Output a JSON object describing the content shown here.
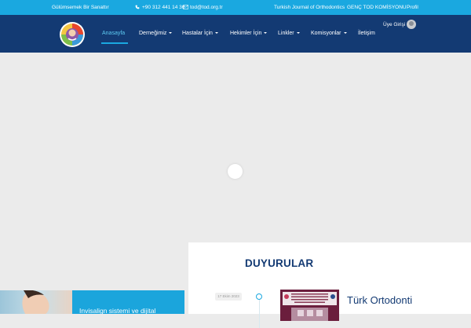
{
  "topbar": {
    "slogan": "Gülümsemek Bir Sanattır",
    "phone": "+90 312 441 14 36",
    "email": "tod@tod.org.tr",
    "journal_link": "Turkish Journal of Orthodontics",
    "genc_link": "GENÇ TOD KOMİSYONU",
    "profile_link": "Profil"
  },
  "nav": {
    "items": [
      {
        "label": "Anasayfa"
      },
      {
        "label": "Derneğimiz"
      },
      {
        "label": "Hastalar İçin"
      },
      {
        "label": "Hekimler İçin"
      },
      {
        "label": "Linkler"
      },
      {
        "label": "Komisyonlar"
      },
      {
        "label": "İletişim"
      }
    ],
    "login_label": "Üye Girişi"
  },
  "announcements": {
    "title": "DUYURULAR",
    "date": "17 Ekim 2023",
    "headline": "Türk Ortodonti"
  },
  "promo": {
    "text": "Invisalign sistemi ve dijital"
  },
  "colors": {
    "topbar": "#1aa8e0",
    "nav": "#133a73",
    "accent": "#5ecbf2",
    "heading": "#133a73"
  }
}
